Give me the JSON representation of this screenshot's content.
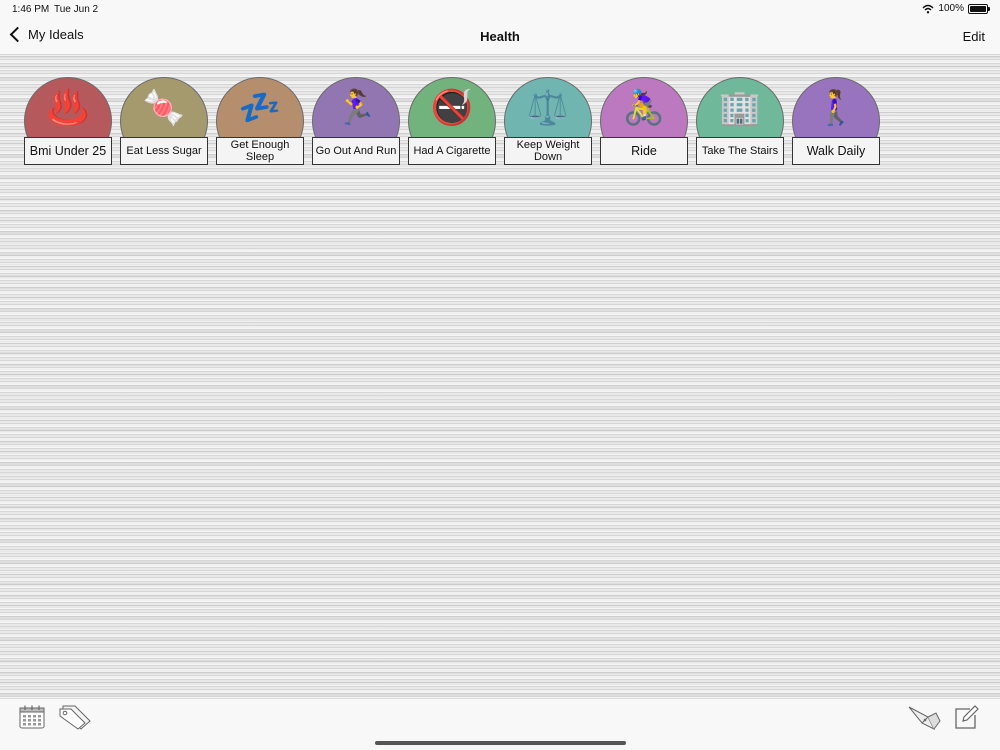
{
  "status_bar": {
    "time": "1:46 PM",
    "date": "Tue Jun 2",
    "battery": "100%",
    "battery_level": 1.0
  },
  "nav": {
    "back_label": "My Ideals",
    "title": "Health",
    "edit_label": "Edit"
  },
  "ideals": [
    {
      "label": "Bmi Under 25",
      "emoji": "♨️",
      "color": "#b5595d",
      "icon": "hot-springs-icon"
    },
    {
      "label": "Eat Less Sugar",
      "emoji": "🍬",
      "color": "#a49a6e",
      "icon": "candy-icon"
    },
    {
      "label": "Get Enough Sleep",
      "emoji": "💤",
      "color": "#b58e6d",
      "icon": "zzz-icon"
    },
    {
      "label": "Go Out And Run",
      "emoji": "🏃‍♀️",
      "color": "#9176b1",
      "icon": "runner-icon"
    },
    {
      "label": "Had A Cigarette",
      "emoji": "🚭",
      "color": "#72b27d",
      "icon": "no-smoking-icon"
    },
    {
      "label": "Keep Weight Down",
      "emoji": "⚖️",
      "color": "#71b5b0",
      "icon": "scale-icon"
    },
    {
      "label": "Ride",
      "emoji": "🚴‍♀️",
      "color": "#bc79bf",
      "icon": "cyclist-icon"
    },
    {
      "label": "Take The Stairs",
      "emoji": "🏢",
      "color": "#6fb89a",
      "icon": "building-icon"
    },
    {
      "label": "Walk Daily",
      "emoji": "🚶‍♀️",
      "color": "#9774bd",
      "icon": "walker-icon"
    }
  ]
}
